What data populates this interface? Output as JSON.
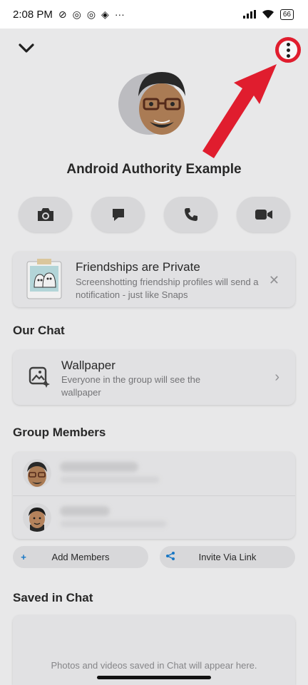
{
  "status": {
    "time": "2:08 PM",
    "battery": "66",
    "icons": [
      "do-not-disturb-icon",
      "whatsapp-icon",
      "whatsapp-icon",
      "snapchat-icon",
      "more-icon",
      "signal-icon",
      "wifi-icon"
    ]
  },
  "header": {
    "back_icon": "chevron-down-icon",
    "more_icon": "more-vertical-icon"
  },
  "group": {
    "name": "Android Authority Example"
  },
  "actions": [
    {
      "icon": "camera-icon"
    },
    {
      "icon": "chat-icon"
    },
    {
      "icon": "phone-icon"
    },
    {
      "icon": "video-icon"
    }
  ],
  "friendships": {
    "title": "Friendships are Private",
    "subtitle": "Screenshotting friendship profiles will send a notification - just like Snaps",
    "close_icon": "close-icon"
  },
  "our_chat": {
    "section_title": "Our Chat",
    "wallpaper_title": "Wallpaper",
    "wallpaper_subtitle": "Everyone in the group will see the wallpaper",
    "chevron_icon": "chevron-right-icon"
  },
  "members": {
    "section_title": "Group Members",
    "add_label": "Add Members",
    "invite_label": "Invite Via Link",
    "add_icon": "plus-icon",
    "invite_icon": "share-icon"
  },
  "saved": {
    "section_title": "Saved in Chat",
    "empty_text": "Photos and videos saved in Chat will appear here."
  },
  "colors": {
    "annotation_red": "#e01d2e",
    "accent_blue": "#1a7fd1"
  }
}
